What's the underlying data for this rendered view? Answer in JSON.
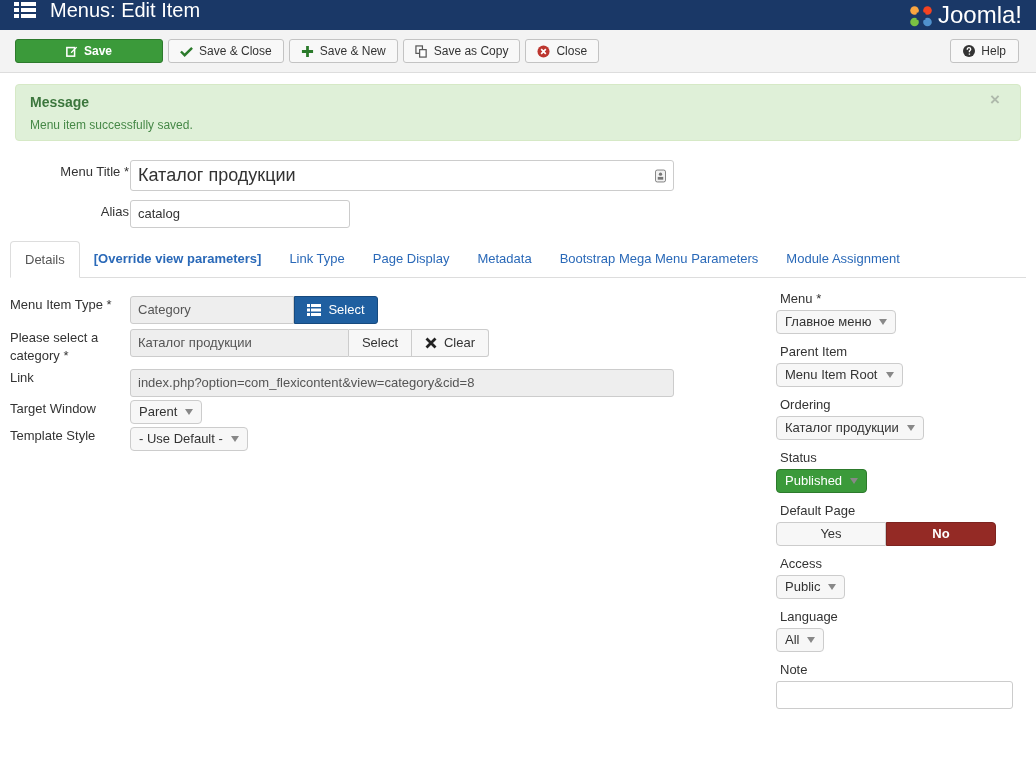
{
  "header": {
    "title": "Menus: Edit Item",
    "brand": "Joomla!"
  },
  "toolbar": {
    "buttons": [
      {
        "label": "Save",
        "kind": "primary"
      },
      {
        "label": "Save & Close",
        "kind": "default"
      },
      {
        "label": "Save & New",
        "kind": "default"
      },
      {
        "label": "Save as Copy",
        "kind": "default"
      },
      {
        "label": "Close",
        "kind": "default"
      }
    ],
    "help": {
      "label": "Help"
    }
  },
  "message": {
    "heading": "Message",
    "text": "Menu item successfully saved.",
    "close": "×"
  },
  "title_field": {
    "label": "Menu Title *",
    "value": "Каталог продукции"
  },
  "alias_field": {
    "label": "Alias",
    "value": "catalog"
  },
  "tabs": [
    {
      "label": "Details",
      "selected": true,
      "bold": false
    },
    {
      "label": "[Override view parameters]",
      "selected": false,
      "bold": true
    },
    {
      "label": "Link Type",
      "selected": false,
      "bold": false
    },
    {
      "label": "Page Display",
      "selected": false,
      "bold": false
    },
    {
      "label": "Metadata",
      "selected": false,
      "bold": false
    },
    {
      "label": "Bootstrap Mega Menu Parameters",
      "selected": false,
      "bold": false
    },
    {
      "label": "Module Assignment",
      "selected": false,
      "bold": false
    }
  ],
  "details": [
    {
      "kind": "picker",
      "label": "Menu Item Type *",
      "value": "Category",
      "button": "Select"
    },
    {
      "kind": "category",
      "label": "Please select a category *",
      "value": "Каталог продукции",
      "select": "Select",
      "clear": "Clear"
    },
    {
      "kind": "readonly",
      "label": "Link",
      "value": "index.php?option=com_flexicontent&view=category&cid=8"
    },
    {
      "kind": "dropdown",
      "label": "Target Window",
      "value": "Parent"
    },
    {
      "kind": "dropdown",
      "label": "Template Style",
      "value": "- Use Default -"
    }
  ],
  "sidebar": [
    {
      "kind": "dropdown",
      "label": "Menu *",
      "value": "Главное меню"
    },
    {
      "kind": "dropdown",
      "label": "Parent Item",
      "value": "Menu Item Root"
    },
    {
      "kind": "dropdown",
      "label": "Ordering",
      "value": "Каталог продукции"
    },
    {
      "kind": "status",
      "label": "Status",
      "value": "Published"
    },
    {
      "kind": "toggle",
      "label": "Default Page",
      "options": [
        {
          "label": "Yes",
          "selected": false
        },
        {
          "label": "No",
          "selected": true
        }
      ]
    },
    {
      "kind": "dropdown",
      "label": "Access",
      "value": "Public"
    },
    {
      "kind": "dropdown",
      "label": "Language",
      "value": "All"
    },
    {
      "kind": "text",
      "label": "Note"
    }
  ]
}
